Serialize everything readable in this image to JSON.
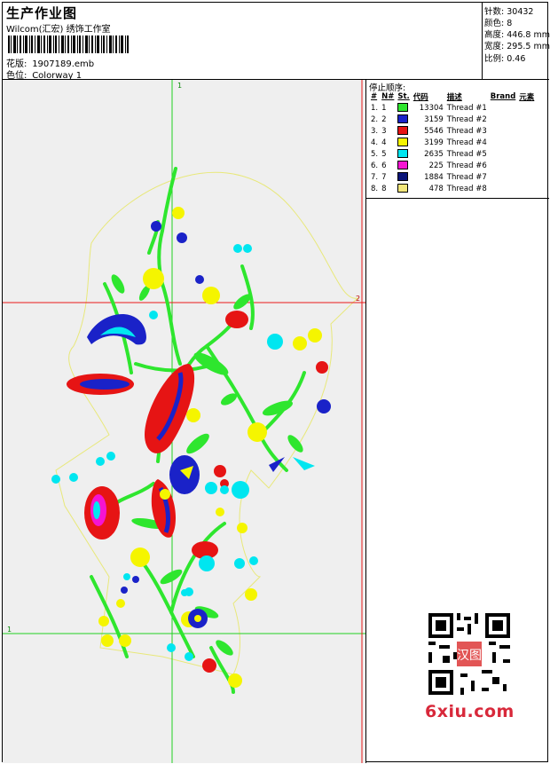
{
  "header": {
    "title": "生产作业图",
    "studio": "Wilcom(汇宏) 绣饰工作室",
    "design_label": "花版:",
    "design_file": "1907189.emb",
    "colorway_label": "色位:",
    "colorway": "Colorway 1"
  },
  "stats": [
    {
      "label": "针数:",
      "value": "30432"
    },
    {
      "label": "颜色:",
      "value": "8"
    },
    {
      "label": "高度:",
      "value": "446.8 mm"
    },
    {
      "label": "宽度:",
      "value": "295.5 mm"
    },
    {
      "label": "比例:",
      "value": "0.46"
    }
  ],
  "stop_sequence": {
    "heading": "停止顺序:",
    "columns": [
      "#",
      "N#",
      "St.",
      "代码",
      "描述",
      "Brand",
      "元素"
    ],
    "rows": [
      {
        "index": "1.",
        "n": "1",
        "color": "#2ee62e",
        "stitches": "13304",
        "desc": "Thread #1"
      },
      {
        "index": "2.",
        "n": "2",
        "color": "#1a22c8",
        "stitches": "3159",
        "desc": "Thread #2"
      },
      {
        "index": "3.",
        "n": "3",
        "color": "#e61414",
        "stitches": "5546",
        "desc": "Thread #3"
      },
      {
        "index": "4.",
        "n": "4",
        "color": "#f5f500",
        "stitches": "3199",
        "desc": "Thread #4"
      },
      {
        "index": "5.",
        "n": "5",
        "color": "#00e6f0",
        "stitches": "2635",
        "desc": "Thread #5"
      },
      {
        "index": "6.",
        "n": "6",
        "color": "#f514d2",
        "stitches": "225",
        "desc": "Thread #6"
      },
      {
        "index": "7.",
        "n": "7",
        "color": "#0a1478",
        "stitches": "1884",
        "desc": "Thread #7"
      },
      {
        "index": "8.",
        "n": "8",
        "color": "#f2e67a",
        "stitches": "478",
        "desc": "Thread #8"
      }
    ]
  },
  "canvas": {
    "guide_labels": {
      "top": "1",
      "right": "2",
      "left": "1"
    }
  },
  "watermark": {
    "logo": "6xiu.com",
    "qr_badge": "汉图"
  }
}
